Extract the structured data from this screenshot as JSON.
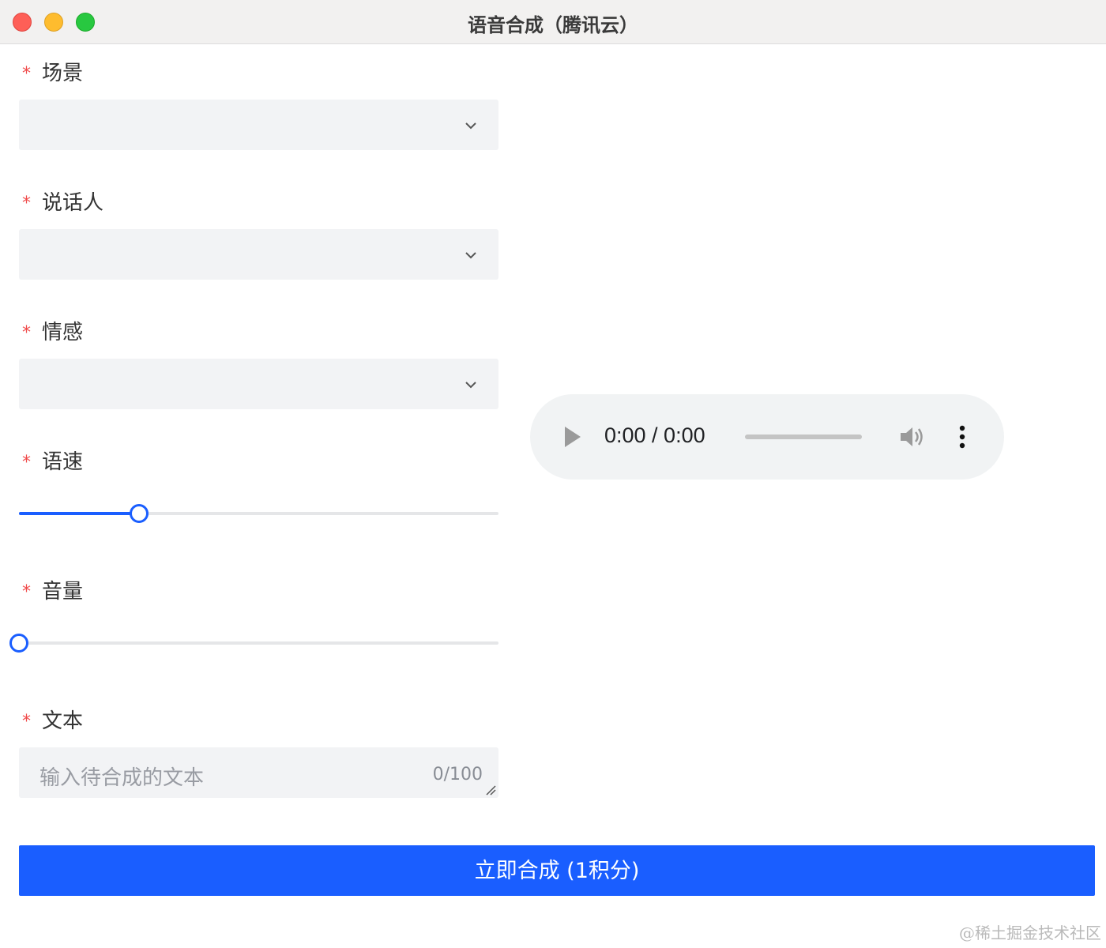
{
  "window": {
    "title": "语音合成（腾讯云）"
  },
  "form": {
    "required_mark": "*",
    "scene": {
      "label": "场景",
      "value": ""
    },
    "speaker": {
      "label": "说话人",
      "value": ""
    },
    "emotion": {
      "label": "情感",
      "value": ""
    },
    "speed": {
      "label": "语速",
      "fraction": 0.25
    },
    "volume": {
      "label": "音量",
      "fraction": 0.0
    },
    "text": {
      "label": "文本",
      "placeholder": "输入待合成的文本",
      "counter": "0/100"
    }
  },
  "audio_player": {
    "time": "0:00 / 0:00",
    "progress": 0
  },
  "submit_button": {
    "label": "立即合成 (1积分)"
  },
  "watermark": "@稀土掘金技术社区",
  "colors": {
    "accent": "#1a5eff",
    "required": "#f04a4a",
    "field_bg": "#f2f3f5"
  }
}
